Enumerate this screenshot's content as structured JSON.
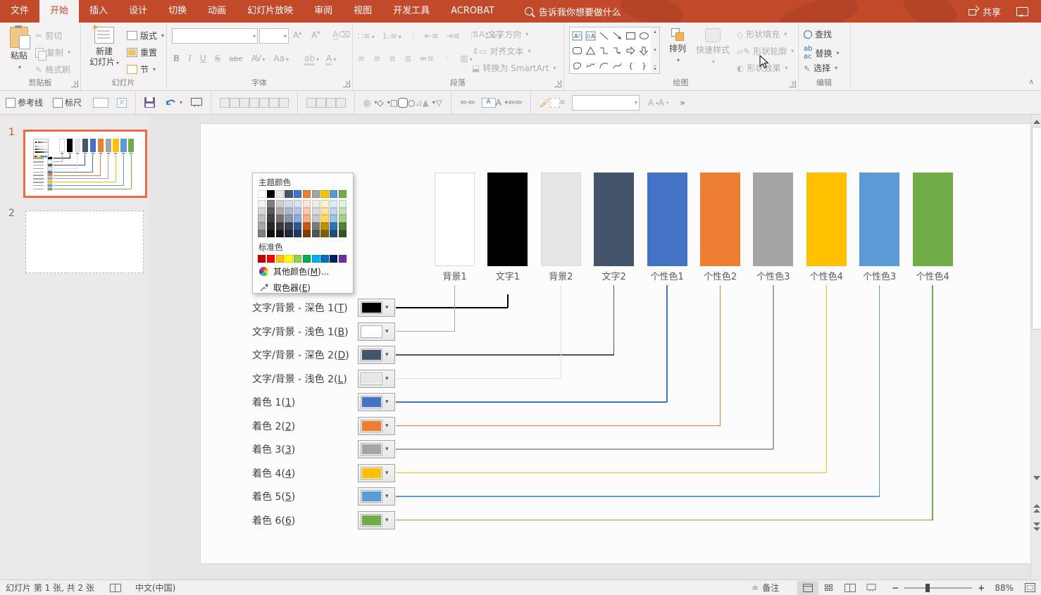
{
  "titlebar": {
    "tabs": [
      "文件",
      "开始",
      "插入",
      "设计",
      "切换",
      "动画",
      "幻灯片放映",
      "审阅",
      "视图",
      "开发工具",
      "ACROBAT"
    ],
    "active_tab": "开始",
    "search_label": "告诉我你想要做什么",
    "share_label": "共享"
  },
  "ribbon": {
    "clipboard": {
      "label": "剪贴板",
      "paste": "粘贴",
      "cut": "剪切",
      "copy": "复制",
      "format_painter": "格式刷"
    },
    "slides": {
      "label": "幻灯片",
      "new_slide_line1": "新建",
      "new_slide_line2": "幻灯片",
      "layout": "版式",
      "reset": "重置",
      "section": "节"
    },
    "font": {
      "label": "字体",
      "bold": "B",
      "italic": "I",
      "underline": "U",
      "strike": "S",
      "abc": "abc",
      "av": "AV",
      "aa": "Aa",
      "color_a": "A",
      "grow": "A",
      "shrink": "A"
    },
    "paragraph": {
      "label": "段落",
      "text_direction": "文字方向",
      "align_text": "对齐文本",
      "smartart": "转换为 SmartArt"
    },
    "drawing": {
      "label": "绘图",
      "arrange": "排列",
      "quick_styles": "快速样式",
      "shape_fill": "形状填充",
      "shape_outline": "形状轮廓",
      "shape_effects": "形状效果"
    },
    "editing": {
      "label": "编辑",
      "find": "查找",
      "replace": "替换",
      "select": "选择"
    }
  },
  "quickbar": {
    "guides": "参考线",
    "ruler": "标尺"
  },
  "slide_panel": {
    "slide1_num": "1",
    "slide2_num": "2"
  },
  "picker": {
    "theme_header": "主题颜色",
    "standard_header": "标准色",
    "more_pre": "其他颜色(",
    "more_key": "M",
    "more_post": ")...",
    "dropper_pre": "取色器(",
    "dropper_key": "E",
    "dropper_post": ")",
    "theme_colors": [
      "#FFFFFF",
      "#000000",
      "#E7E6E6",
      "#44546A",
      "#4472C4",
      "#ED7D31",
      "#A5A5A5",
      "#FFC000",
      "#5B9BD5",
      "#70AD47"
    ],
    "variants": [
      [
        "#F2F2F2",
        "#7F7F7F",
        "#D0CECE",
        "#D6DCE5",
        "#DAE3F3",
        "#FBE5D6",
        "#EDEDED",
        "#FFF2CC",
        "#DEEBF7",
        "#E2F0D9"
      ],
      [
        "#D9D9D9",
        "#595959",
        "#AEAAAA",
        "#ACB9CA",
        "#B4C7E7",
        "#F8CBAD",
        "#DBDBDB",
        "#FFE599",
        "#BDD7EE",
        "#C5E0B4"
      ],
      [
        "#BFBFBF",
        "#404040",
        "#757171",
        "#8496B0",
        "#8FAADC",
        "#F4B183",
        "#C9C9C9",
        "#FFD966",
        "#9DC3E6",
        "#A9D18E"
      ],
      [
        "#A6A6A6",
        "#262626",
        "#3B3838",
        "#333F50",
        "#2F5597",
        "#C55A11",
        "#7B7B7B",
        "#BF9000",
        "#2E75B6",
        "#548235"
      ],
      [
        "#7F7F7F",
        "#0D0D0D",
        "#171616",
        "#222A35",
        "#1F3864",
        "#833C00",
        "#525252",
        "#7F6000",
        "#1F4E79",
        "#375623"
      ]
    ],
    "standard_colors": [
      "#C00000",
      "#FF0000",
      "#FFC000",
      "#FFFF00",
      "#92D050",
      "#00B050",
      "#00B0F0",
      "#0070C0",
      "#002060",
      "#7030A0"
    ]
  },
  "diagram": {
    "bars": [
      {
        "label": "背景1",
        "color": "#FFFFFF"
      },
      {
        "label": "文字1",
        "color": "#000000"
      },
      {
        "label": "背景2",
        "color": "#E7E6E6"
      },
      {
        "label": "文字2",
        "color": "#44546A"
      },
      {
        "label": "个性色1",
        "color": "#4472C4"
      },
      {
        "label": "个性色2",
        "color": "#ED7D31"
      },
      {
        "label": "个性色3",
        "color": "#A5A5A5"
      },
      {
        "label": "个性色4",
        "color": "#FFC000"
      },
      {
        "label": "个性色3",
        "color": "#5B9BD5"
      },
      {
        "label": "个性色4",
        "color": "#70AD47"
      }
    ],
    "rows": [
      {
        "pre": "文字/背景 - 深色 1(",
        "key": "T",
        "post": ")",
        "swatch": "#000000",
        "line": "#000000",
        "target": 1
      },
      {
        "pre": "文字/背景 - 浅色 1(",
        "key": "B",
        "post": ")",
        "swatch": "#FFFFFF",
        "line": "#A6A6A6",
        "target": 0
      },
      {
        "pre": "文字/背景 - 深色 2(",
        "key": "D",
        "post": ")",
        "swatch": "#44546A",
        "line": "#44546A",
        "target": 3
      },
      {
        "pre": "文字/背景 - 浅色 2(",
        "key": "L",
        "post": ")",
        "swatch": "#E7E6E6",
        "line": "#E3E1E1",
        "target": 2
      },
      {
        "pre": "着色 1(",
        "key": "1",
        "post": ")",
        "swatch": "#4472C4",
        "line": "#4472C4",
        "target": 4
      },
      {
        "pre": "着色 2(",
        "key": "2",
        "post": ")",
        "swatch": "#ED7D31",
        "line": "#ED7D31",
        "target": 5
      },
      {
        "pre": "着色 3(",
        "key": "3",
        "post": ")",
        "swatch": "#A5A5A5",
        "line": "#A5A5A5",
        "target": 6
      },
      {
        "pre": "着色 4(",
        "key": "4",
        "post": ")",
        "swatch": "#FFC000",
        "line": "#FFC000",
        "target": 7
      },
      {
        "pre": "着色 5(",
        "key": "5",
        "post": ")",
        "swatch": "#5B9BD5",
        "line": "#5B9BD5",
        "target": 8
      },
      {
        "pre": "着色 6(",
        "key": "6",
        "post": ")",
        "swatch": "#70AD47",
        "line": "#70AD47",
        "target": 9
      }
    ]
  },
  "statusbar": {
    "slide_info": "幻灯片 第 1 张, 共 2 张",
    "language": "中文(中国)",
    "notes": "备注",
    "zoom_level": "88%"
  },
  "colors": {
    "titlebar": "#C3492B",
    "selected_slide_border": "#EC6B40"
  }
}
